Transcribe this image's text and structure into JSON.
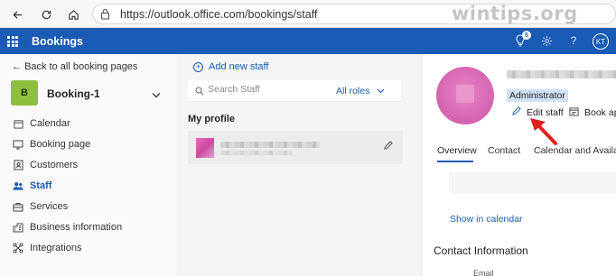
{
  "browser": {
    "url": "https://outlook.office.com/bookings/staff",
    "watermark": "wintips.org",
    "watermark_badge": "tips"
  },
  "header": {
    "title": "Bookings",
    "notification_count": "5",
    "avatar_initials": "KT",
    "accent": "#1a5bb5"
  },
  "sidebar": {
    "back_label": "Back to all booking pages",
    "business_initial": "B",
    "business_name": "Booking-1",
    "items": [
      {
        "label": "Calendar",
        "icon": "calendar-icon"
      },
      {
        "label": "Booking page",
        "icon": "monitor-icon"
      },
      {
        "label": "Customers",
        "icon": "contact-card-icon"
      },
      {
        "label": "Staff",
        "icon": "people-icon",
        "active": true
      },
      {
        "label": "Services",
        "icon": "services-icon"
      },
      {
        "label": "Business information",
        "icon": "building-icon"
      },
      {
        "label": "Integrations",
        "icon": "integrations-icon"
      }
    ]
  },
  "staff_list": {
    "add_label": "Add new staff",
    "search_placeholder": "Search Staff",
    "roles_filter": "All roles",
    "section_title": "My profile"
  },
  "detail": {
    "role": "Administrator",
    "edit_label": "Edit staff",
    "book_label": "Book ap",
    "tabs": [
      "Overview",
      "Contact",
      "Calendar and Availabili"
    ],
    "show_calendar": "Show in calendar",
    "contact_heading": "Contact Information",
    "email_label": "Email"
  }
}
